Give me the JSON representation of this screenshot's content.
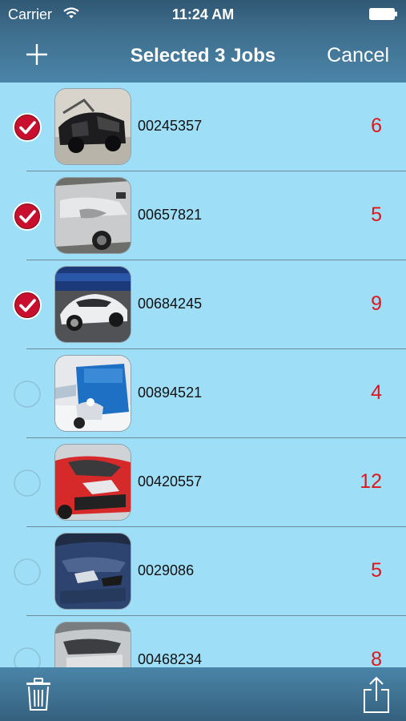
{
  "status": {
    "carrier": "Carrier",
    "time": "11:24 AM"
  },
  "nav": {
    "add_icon": "plus-icon",
    "title": "Selected 3 Jobs",
    "cancel": "Cancel"
  },
  "jobs": [
    {
      "id": "00245357",
      "count": "6",
      "selected": true,
      "thumb": "black-sedan-damaged"
    },
    {
      "id": "00657821",
      "count": "5",
      "selected": true,
      "thumb": "silver-car-dented-door"
    },
    {
      "id": "00684245",
      "count": "9",
      "selected": true,
      "thumb": "silver-sports-car"
    },
    {
      "id": "00894521",
      "count": "4",
      "selected": false,
      "thumb": "blue-car-snow"
    },
    {
      "id": "00420557",
      "count": "12",
      "selected": false,
      "thumb": "red-car-front-damage"
    },
    {
      "id": "0029086",
      "count": "5",
      "selected": false,
      "thumb": "dark-blue-car-front-damage"
    },
    {
      "id": "00468234",
      "count": "8",
      "selected": false,
      "thumb": "silver-car-side"
    }
  ],
  "toolbar": {
    "trash_icon": "trash-icon",
    "share_icon": "share-icon"
  },
  "colors": {
    "count": "#e2141c",
    "check": "#c8102e",
    "list_bg": "#9edff7",
    "bar": "#3f6f8e"
  }
}
